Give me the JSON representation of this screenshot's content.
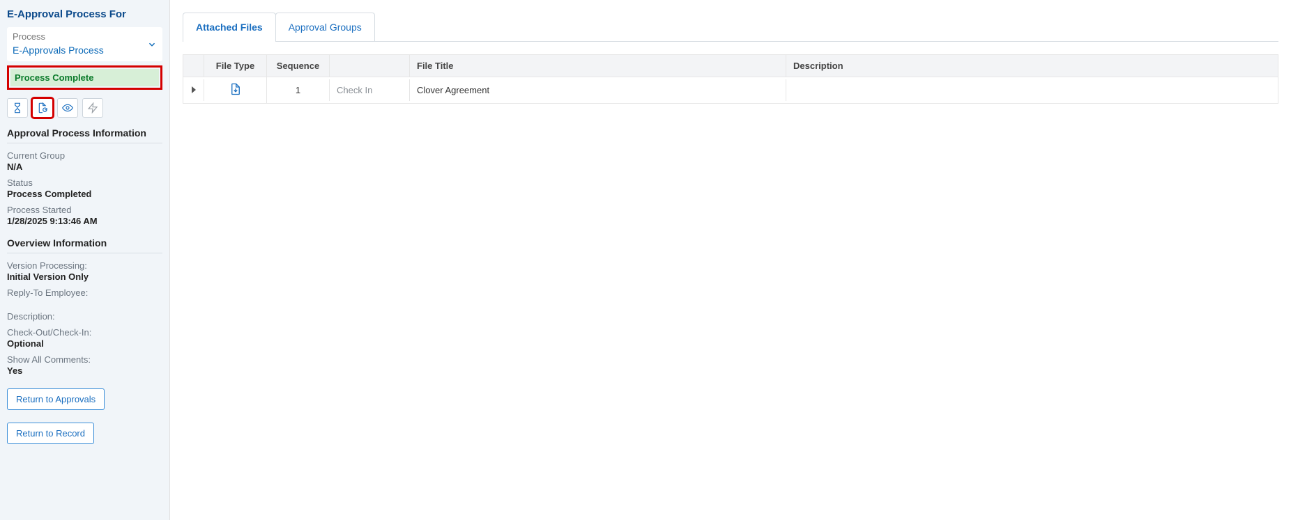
{
  "sidebar": {
    "title": "E-Approval Process For",
    "process_label": "Process",
    "process_value": "E-Approvals Process",
    "status_banner": "Process Complete",
    "approval_info": {
      "heading": "Approval Process Information",
      "current_group_label": "Current Group",
      "current_group_value": "N/A",
      "status_label": "Status",
      "status_value": "Process Completed",
      "started_label": "Process Started",
      "started_value": "1/28/2025 9:13:46 AM"
    },
    "overview": {
      "heading": "Overview Information",
      "version_processing_label": "Version Processing:",
      "version_processing_value": "Initial Version Only",
      "reply_to_label": "Reply-To Employee:",
      "reply_to_value": "",
      "description_label": "Description:",
      "description_value": "",
      "checkout_label": "Check-Out/Check-In:",
      "checkout_value": "Optional",
      "show_comments_label": "Show All Comments:",
      "show_comments_value": "Yes"
    },
    "buttons": {
      "return_to_approvals": "Return to Approvals",
      "return_to_record": "Return to Record"
    }
  },
  "main": {
    "tabs": {
      "attached_files": "Attached Files",
      "approval_groups": "Approval Groups"
    },
    "grid": {
      "headers": {
        "file_type": "File Type",
        "sequence": "Sequence",
        "file_title": "File Title",
        "description": "Description"
      },
      "rows": [
        {
          "sequence": "1",
          "action": "Check In",
          "title": "Clover Agreement",
          "description": ""
        }
      ]
    }
  }
}
